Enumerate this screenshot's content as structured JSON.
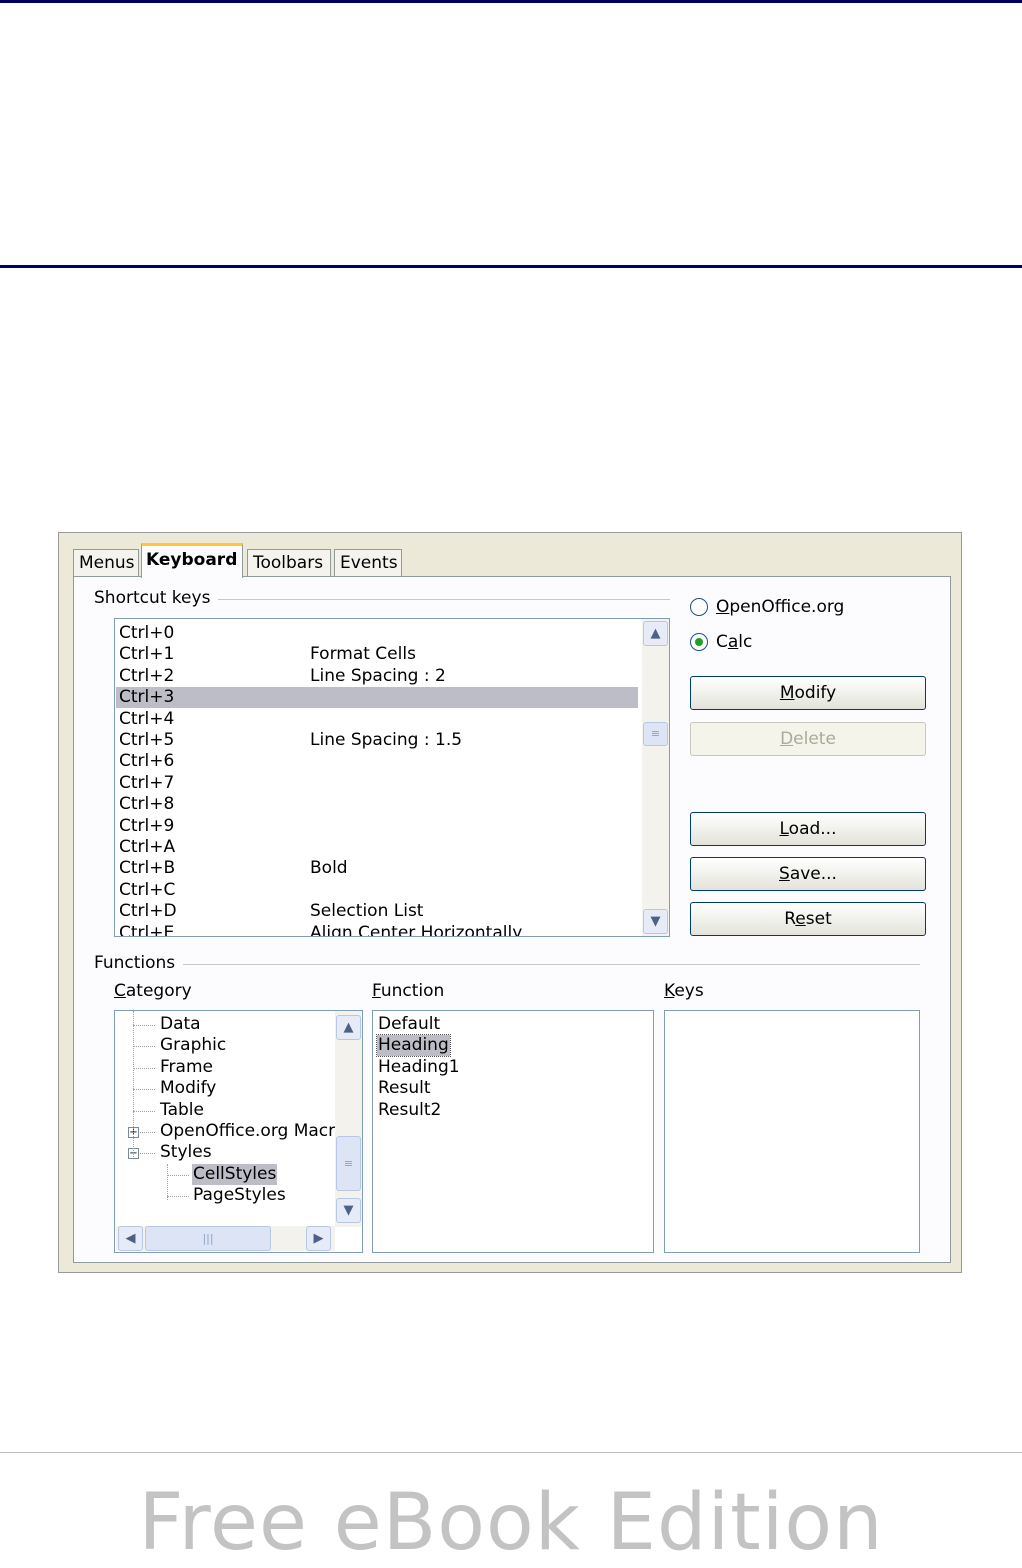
{
  "tabs": [
    "Menus",
    "Keyboard",
    "Toolbars",
    "Events"
  ],
  "shortcut_keys": {
    "title": "Shortcut keys",
    "rows": [
      {
        "key": "Ctrl+0",
        "function": ""
      },
      {
        "key": "Ctrl+1",
        "function": "Format Cells"
      },
      {
        "key": "Ctrl+2",
        "function": "Line Spacing : 2"
      },
      {
        "key": "Ctrl+3",
        "function": ""
      },
      {
        "key": "Ctrl+4",
        "function": ""
      },
      {
        "key": "Ctrl+5",
        "function": "Line Spacing : 1.5"
      },
      {
        "key": "Ctrl+6",
        "function": ""
      },
      {
        "key": "Ctrl+7",
        "function": ""
      },
      {
        "key": "Ctrl+8",
        "function": ""
      },
      {
        "key": "Ctrl+9",
        "function": ""
      },
      {
        "key": "Ctrl+A",
        "function": ""
      },
      {
        "key": "Ctrl+B",
        "function": "Bold"
      },
      {
        "key": "Ctrl+C",
        "function": ""
      },
      {
        "key": "Ctrl+D",
        "function": "Selection List"
      },
      {
        "key": "Ctrl+E",
        "function": "Align Center Horizontally"
      }
    ],
    "selected_index": 3
  },
  "scope": {
    "openoffice": {
      "pre": "",
      "u": "O",
      "post": "penOffice.org"
    },
    "calc": {
      "pre": "C",
      "u": "a",
      "post": "lc"
    },
    "selected": "calc"
  },
  "buttons": {
    "modify": {
      "pre": "",
      "u": "M",
      "post": "odify"
    },
    "delete": {
      "pre": "",
      "u": "D",
      "post": "elete"
    },
    "load": {
      "pre": "",
      "u": "L",
      "post": "oad..."
    },
    "save": {
      "pre": "",
      "u": "S",
      "post": "ave..."
    },
    "reset": {
      "pre": "R",
      "u": "e",
      "post": "set"
    }
  },
  "functions": {
    "title": "Functions",
    "category_label": {
      "u": "C",
      "post": "ategory"
    },
    "function_label": {
      "u": "F",
      "post": "unction"
    },
    "keys_label": {
      "u": "K",
      "post": "eys"
    },
    "categories": [
      {
        "label": "Data",
        "level": 1
      },
      {
        "label": "Graphic",
        "level": 1
      },
      {
        "label": "Frame",
        "level": 1
      },
      {
        "label": "Modify",
        "level": 1
      },
      {
        "label": "Table",
        "level": 1
      },
      {
        "label": "OpenOffice.org Macro",
        "level": 1,
        "expander": "+"
      },
      {
        "label": "Styles",
        "level": 1,
        "expander": "−"
      },
      {
        "label": "CellStyles",
        "level": 2,
        "selected": true
      },
      {
        "label": "PageStyles",
        "level": 2
      }
    ],
    "function_items": [
      "Default",
      "Heading",
      "Heading1",
      "Result",
      "Result2"
    ],
    "function_selected_index": 1
  },
  "footer": {
    "watermark": "Free eBook Edition"
  }
}
